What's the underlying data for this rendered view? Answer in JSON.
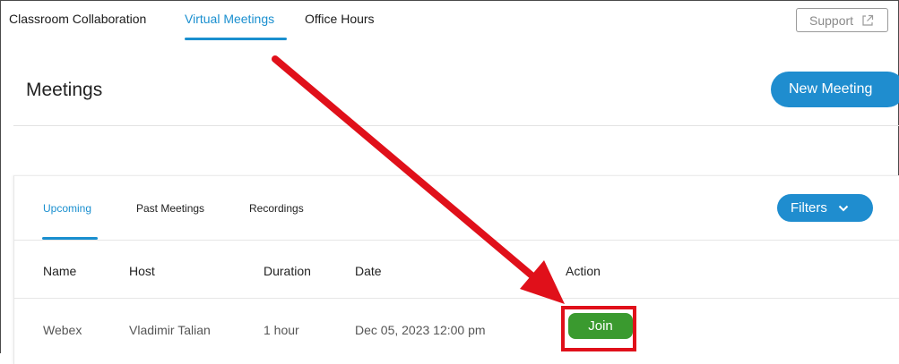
{
  "nav": {
    "tabs": [
      {
        "label": "Classroom Collaboration"
      },
      {
        "label": "Virtual Meetings",
        "active": true
      },
      {
        "label": "Office Hours"
      }
    ],
    "support_label": "Support",
    "support_icon": "external-link-icon"
  },
  "header": {
    "title": "Meetings",
    "new_meeting_label": "New Meeting"
  },
  "meetings": {
    "subtabs": [
      {
        "label": "Upcoming",
        "active": true
      },
      {
        "label": "Past Meetings"
      },
      {
        "label": "Recordings"
      }
    ],
    "filters_label": "Filters",
    "filters_icon": "chevron-down-icon",
    "columns": [
      "Name",
      "Host",
      "Duration",
      "Date",
      "Action"
    ],
    "rows": [
      {
        "name": "Webex",
        "host": "Vladimir Talian",
        "duration": "1 hour",
        "date": "Dec 05, 2023 12:00 pm",
        "action_label": "Join"
      }
    ]
  },
  "annotation": {
    "highlight_color": "#e0101a",
    "arrow_color": "#e0101a"
  },
  "colors": {
    "accent": "#1f8dcf",
    "join": "#3a9a2f"
  }
}
